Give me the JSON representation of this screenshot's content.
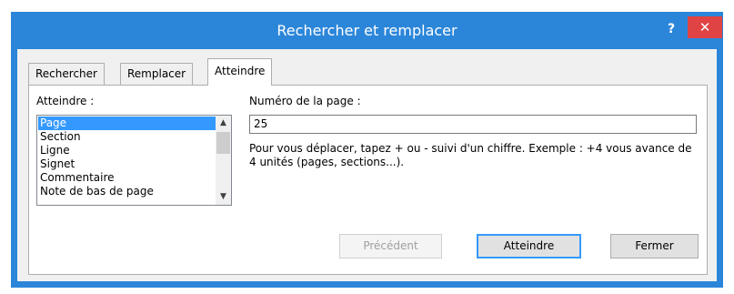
{
  "window": {
    "title": "Rechercher et remplacer",
    "help_label": "?",
    "close_label": "✕"
  },
  "tabs": [
    {
      "label": "Rechercher",
      "active": false
    },
    {
      "label": "Remplacer",
      "active": false
    },
    {
      "label": "Atteindre",
      "active": true
    }
  ],
  "goto": {
    "list_label": "Atteindre :",
    "items": [
      "Page",
      "Section",
      "Ligne",
      "Signet",
      "Commentaire",
      "Note de bas de page"
    ],
    "selected": "Page",
    "input_label": "Numéro de la page :",
    "input_value": "25",
    "hint": "Pour vous déplacer, tapez + ou - suivi d'un chiffre. Exemple : +4 vous avance de 4 unités (pages, sections...)."
  },
  "buttons": {
    "previous": "Précédent",
    "goto": "Atteindre",
    "close": "Fermer"
  },
  "colors": {
    "titlebar": "#2b86d9",
    "close": "#e04343",
    "selection": "#3399ff"
  }
}
